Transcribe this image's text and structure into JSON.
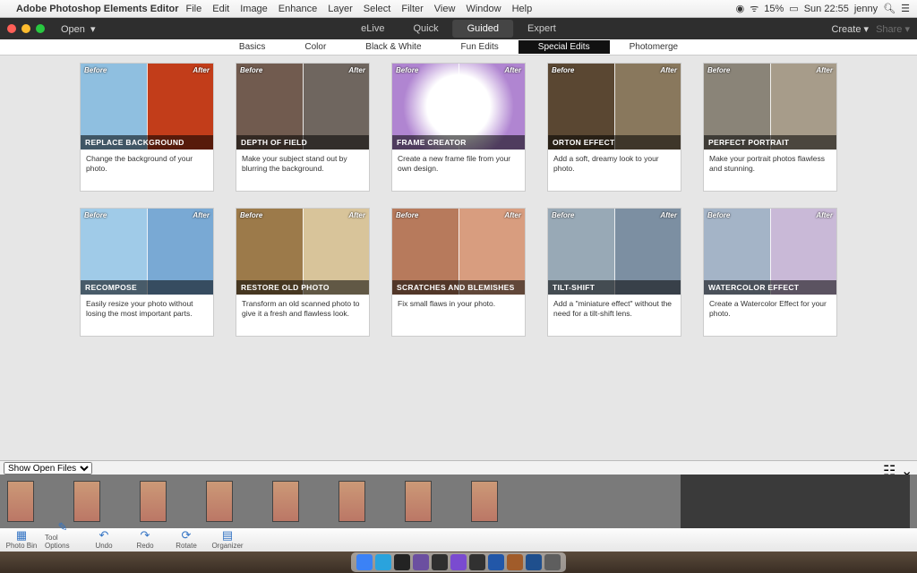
{
  "menubar": {
    "app_name": "Adobe Photoshop Elements Editor",
    "items": [
      "File",
      "Edit",
      "Image",
      "Enhance",
      "Layer",
      "Select",
      "Filter",
      "View",
      "Window",
      "Help"
    ],
    "status": {
      "battery": "15%",
      "day_time": "Sun 22:55",
      "user": "jenny"
    }
  },
  "toolbar": {
    "open": "Open",
    "modes": [
      "eLive",
      "Quick",
      "Guided",
      "Expert"
    ],
    "active_mode": "Guided",
    "create": "Create",
    "share": "Share"
  },
  "subtabs": {
    "items": [
      "Basics",
      "Color",
      "Black & White",
      "Fun Edits",
      "Special Edits",
      "Photomerge"
    ],
    "active": "Special Edits"
  },
  "before_label": "Before",
  "after_label": "After",
  "cards": [
    {
      "title": "REPLACE BACKGROUND",
      "desc": "Change the background of your photo.",
      "klass": "g1"
    },
    {
      "title": "DEPTH OF FIELD",
      "desc": "Make your subject stand out by blurring the background.",
      "klass": "g2"
    },
    {
      "title": "FRAME CREATOR",
      "desc": "Create a new frame file from your own design.",
      "klass": "g3"
    },
    {
      "title": "ORTON EFFECT",
      "desc": "Add a soft, dreamy look to your photo.",
      "klass": "g4"
    },
    {
      "title": "PERFECT PORTRAIT",
      "desc": "Make your portrait photos flawless and stunning.",
      "klass": "g5"
    },
    {
      "title": "RECOMPOSE",
      "desc": "Easily resize your photo without losing the most important parts.",
      "klass": "g6"
    },
    {
      "title": "RESTORE OLD PHOTO",
      "desc": "Transform an old scanned photo to give it a fresh and flawless look.",
      "klass": "g7"
    },
    {
      "title": "SCRATCHES AND BLEMISHES",
      "desc": "Fix small flaws in your photo.",
      "klass": "g8"
    },
    {
      "title": "TILT-SHIFT",
      "desc": "Add a \"miniature effect\" without the need for a tilt-shift lens.",
      "klass": "g9"
    },
    {
      "title": "WATERCOLOR EFFECT",
      "desc": "Create a Watercolor Effect for your photo.",
      "klass": "g10"
    }
  ],
  "show_files": "Show Open Files",
  "film_count": 8,
  "tools": [
    {
      "label": "Photo Bin",
      "glyph": "▦"
    },
    {
      "label": "Tool Options",
      "glyph": "✎"
    },
    {
      "label": "Undo",
      "glyph": "↶"
    },
    {
      "label": "Redo",
      "glyph": "↷"
    },
    {
      "label": "Rotate",
      "glyph": "⟳"
    },
    {
      "label": "Organizer",
      "glyph": "▤"
    }
  ],
  "dock_colors": [
    "#3b82f6",
    "#2aa3dd",
    "#232323",
    "#6b4fa0",
    "#2f2f2f",
    "#7a4bd0",
    "#313131",
    "#2257a8",
    "#a15c2a",
    "#1f4f8d",
    "#5e5e5e"
  ]
}
